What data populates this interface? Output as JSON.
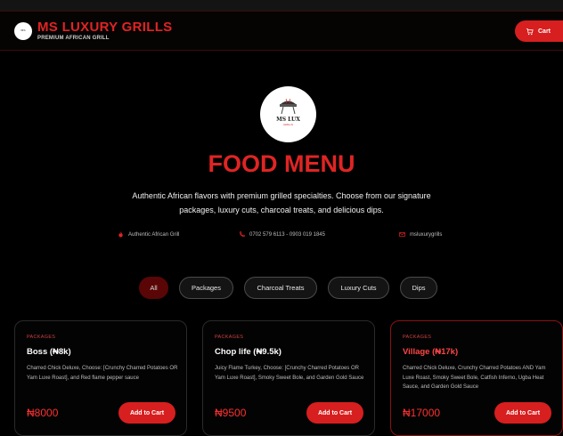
{
  "header": {
    "logo_text": "MS",
    "title": "MS LUXURY GRILLS",
    "subtitle": "PREMIUM AFRICAN GRILL",
    "cart_label": "Cart"
  },
  "hero": {
    "logo_title": "MS LUX",
    "logo_sub": "GRILLS",
    "title": "FOOD MENU",
    "description": "Authentic African flavors with premium grilled specialties. Choose from our signature packages, luxury cuts, charcoal treats, and delicious dips."
  },
  "info": {
    "tagline": "Authentic African Grill",
    "phone": "0702 579 6113 - 0903 019 1845",
    "email": "msluxurygrills"
  },
  "filters": [
    "All",
    "Packages",
    "Charcoal Treats",
    "Luxury Cuts",
    "Dips"
  ],
  "active_filter": "All",
  "products": [
    {
      "category": "PACKAGES",
      "name": "Boss (₦8k)",
      "description": "Charred Chick Deluxe, Choose: [Crunchy Charred Potatoes OR Yam Luxe Roast], and Red flame pepper sauce",
      "price": "₦8000",
      "button": "Add to Cart"
    },
    {
      "category": "PACKAGES",
      "name": "Chop life (₦9.5k)",
      "description": "Juicy Flame Turkey, Choose: [Crunchy Charred Potatoes OR Yam Luxe Roast], Smoky Sweet Bole, and Garden Gold Sauce",
      "price": "₦9500",
      "button": "Add to Cart"
    },
    {
      "category": "PACKAGES",
      "name": "Village (₦17k)",
      "description": "Charred Chick Deluxe, Crunchy Charred Potatoes AND Yam Luxe Roast, Smoky Sweet Bole, Catfish Inferno, Ugba Heat Sauce, and Garden Gold Sauce",
      "price": "₦17000",
      "button": "Add to Cart"
    }
  ],
  "colors": {
    "accent": "#e02424",
    "button": "#d71f1f",
    "background": "#000000"
  }
}
